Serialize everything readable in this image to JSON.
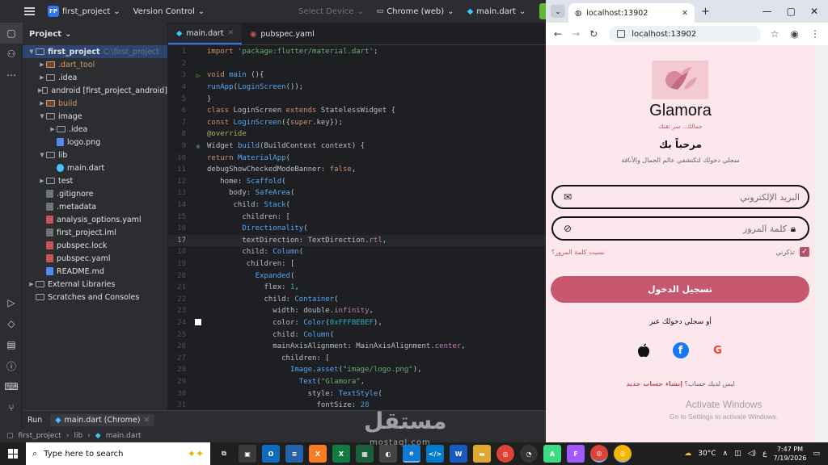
{
  "ide": {
    "project_badge": "FP",
    "project_name": "first_project",
    "vcs": "Version Control",
    "device": "Select Device",
    "browser_target": "Chrome (web)",
    "run_config": "main.dart",
    "panel_title": "Project",
    "tree": [
      {
        "label": "first_project",
        "extra": "C:\\first_project",
        "depth": 0,
        "kind": "folder",
        "open": true,
        "selected": true
      },
      {
        "label": ".dart_tool",
        "depth": 1,
        "kind": "folder-orange",
        "open": false
      },
      {
        "label": ".idea",
        "depth": 1,
        "kind": "folder",
        "open": false
      },
      {
        "label": "android [first_project_android]",
        "depth": 1,
        "kind": "folder",
        "open": false
      },
      {
        "label": "build",
        "depth": 1,
        "kind": "folder-orange",
        "open": false
      },
      {
        "label": "image",
        "depth": 1,
        "kind": "folder",
        "open": true
      },
      {
        "label": ".idea",
        "depth": 2,
        "kind": "folder",
        "open": false
      },
      {
        "label": "logo.png",
        "depth": 2,
        "kind": "img"
      },
      {
        "label": "lib",
        "depth": 1,
        "kind": "folder",
        "open": true
      },
      {
        "label": "main.dart",
        "depth": 2,
        "kind": "dart"
      },
      {
        "label": "test",
        "depth": 1,
        "kind": "folder",
        "open": false
      },
      {
        "label": ".gitignore",
        "depth": 1,
        "kind": "file"
      },
      {
        "label": ".metadata",
        "depth": 1,
        "kind": "file"
      },
      {
        "label": "analysis_options.yaml",
        "depth": 1,
        "kind": "yaml"
      },
      {
        "label": "first_project.iml",
        "depth": 1,
        "kind": "file"
      },
      {
        "label": "pubspec.lock",
        "depth": 1,
        "kind": "yaml"
      },
      {
        "label": "pubspec.yaml",
        "depth": 1,
        "kind": "yaml"
      },
      {
        "label": "README.md",
        "depth": 1,
        "kind": "md"
      },
      {
        "label": "External Libraries",
        "depth": 0,
        "kind": "lib",
        "open": false
      },
      {
        "label": "Scratches and Consoles",
        "depth": 0,
        "kind": "scratch"
      }
    ],
    "tabs": [
      {
        "label": "main.dart",
        "active": true
      },
      {
        "label": "pubspec.yaml",
        "active": false
      }
    ],
    "current_line": 17,
    "code": [
      [
        [
          "kw",
          "import "
        ],
        [
          "str",
          "'package:flutter/material.dart'"
        ],
        [
          "txt",
          ";"
        ]
      ],
      [],
      [
        [
          "kw",
          "void "
        ],
        [
          "cls",
          "main "
        ],
        [
          "txt",
          "(){"
        ]
      ],
      [
        [
          "cls",
          "runApp"
        ],
        [
          "txt",
          "("
        ],
        [
          "cls",
          "LoginScreen"
        ],
        [
          "txt",
          "());"
        ]
      ],
      [
        [
          "txt",
          "}"
        ]
      ],
      [
        [
          "kw",
          "class "
        ],
        [
          "txt",
          "LoginScreen "
        ],
        [
          "kw",
          "extends "
        ],
        [
          "txt",
          "StatelessWidget {"
        ]
      ],
      [
        [
          "kw",
          "const "
        ],
        [
          "cls",
          "LoginScreen"
        ],
        [
          "txt",
          "({"
        ],
        [
          "kw",
          "super"
        ],
        [
          "txt",
          ".key});"
        ]
      ],
      [
        [
          "ann",
          "@override"
        ]
      ],
      [
        [
          "txt",
          "Widget "
        ],
        [
          "cls",
          "build"
        ],
        [
          "txt",
          "(BuildContext context) {"
        ]
      ],
      [
        [
          "kw",
          "return "
        ],
        [
          "cls",
          "MaterialApp"
        ],
        [
          "txt",
          "("
        ]
      ],
      [
        [
          "txt",
          "debugShowCheckedModeBanner: "
        ],
        [
          "kw",
          "false"
        ],
        [
          "txt",
          ","
        ]
      ],
      [
        [
          "txt",
          "   home: "
        ],
        [
          "cls",
          "Scaffold"
        ],
        [
          "txt",
          "("
        ]
      ],
      [
        [
          "txt",
          "     body: "
        ],
        [
          "cls",
          "SafeArea"
        ],
        [
          "txt",
          "("
        ]
      ],
      [
        [
          "txt",
          "      child: "
        ],
        [
          "cls",
          "Stack"
        ],
        [
          "txt",
          "("
        ]
      ],
      [
        [
          "txt",
          "        children: ["
        ]
      ],
      [
        [
          "txt",
          "        "
        ],
        [
          "cls",
          "Directionality"
        ],
        [
          "txt",
          "("
        ]
      ],
      [
        [
          "txt",
          "        textDirection: TextDirection."
        ],
        [
          "fld",
          "rtl"
        ],
        [
          "txt",
          ","
        ]
      ],
      [
        [
          "txt",
          "        child: "
        ],
        [
          "cls",
          "Column"
        ],
        [
          "txt",
          "("
        ]
      ],
      [
        [
          "txt",
          "         children: ["
        ]
      ],
      [
        [
          "txt",
          "           "
        ],
        [
          "cls",
          "Expanded"
        ],
        [
          "txt",
          "("
        ]
      ],
      [
        [
          "txt",
          "             flex: "
        ],
        [
          "num",
          "1"
        ],
        [
          "txt",
          ","
        ]
      ],
      [
        [
          "txt",
          "             child: "
        ],
        [
          "cls",
          "Container"
        ],
        [
          "txt",
          "("
        ]
      ],
      [
        [
          "txt",
          "               width: double."
        ],
        [
          "fld",
          "infinity"
        ],
        [
          "txt",
          ","
        ]
      ],
      [
        [
          "txt",
          "               color: "
        ],
        [
          "cls",
          "Color"
        ],
        [
          "txt",
          "("
        ],
        [
          "num",
          "0xFFFBEBEF"
        ],
        [
          "txt",
          "),"
        ]
      ],
      [
        [
          "txt",
          "               child: "
        ],
        [
          "cls",
          "Column"
        ],
        [
          "txt",
          "("
        ]
      ],
      [
        [
          "txt",
          "               mainAxisAlignment: MainAxisAlignment."
        ],
        [
          "fld",
          "center"
        ],
        [
          "txt",
          ","
        ]
      ],
      [
        [
          "txt",
          "                 children: ["
        ]
      ],
      [
        [
          "txt",
          "                   "
        ],
        [
          "cls",
          "Image"
        ],
        [
          "txt",
          "."
        ],
        [
          "cls",
          "asset"
        ],
        [
          "txt",
          "("
        ],
        [
          "str",
          "\"image/logo.png\""
        ],
        [
          "txt",
          "),"
        ]
      ],
      [
        [
          "txt",
          "                     "
        ],
        [
          "cls",
          "Text"
        ],
        [
          "txt",
          "("
        ],
        [
          "str",
          "\"Glamora\""
        ],
        [
          "txt",
          ","
        ]
      ],
      [
        [
          "txt",
          "                       style: "
        ],
        [
          "cls",
          "TextStyle"
        ],
        [
          "txt",
          "("
        ]
      ],
      [
        [
          "txt",
          "                         fontSize: "
        ],
        [
          "num",
          "28"
        ]
      ]
    ],
    "run_label": "Run",
    "run_tab": "main.dart (Chrome)",
    "status_path": [
      "first_project",
      "lib",
      "main.dart"
    ]
  },
  "browser": {
    "tab_title": "localhost:13902",
    "url": "localhost:13902"
  },
  "app": {
    "brand": "Glamora",
    "tagline": "جمالك.. سر ثقتك",
    "welcome": "مرحباً بك",
    "subtitle": "سجلي دخولك لتكتشفي عالم الجمال والأناقة",
    "email_placeholder": "البريد الإلكتروني",
    "password_placeholder": "كلمة المرور",
    "forgot": "نسيت كلمة المرور؟",
    "remember": "تذكرني",
    "login": "تسجيل الدخول",
    "or_login": "أو سجلي دخولك عبر",
    "no_account": "ليس لديك حساب؟",
    "create_account": "إنشاء حساب جديد",
    "colors": {
      "background": "#FBEBEF",
      "primary": "#C7566F",
      "accent": "#C0566F"
    }
  },
  "activation": {
    "line1": "Activate Windows",
    "line2": "Go to Settings to activate Windows."
  },
  "taskbar": {
    "search_placeholder": "Type here to search",
    "weather": "30°C",
    "lang": "ع",
    "time": "7:47 PM",
    "date": "7/19/2026"
  },
  "watermark": {
    "arabic": "مستقل",
    "latin": "mostaql.com"
  }
}
